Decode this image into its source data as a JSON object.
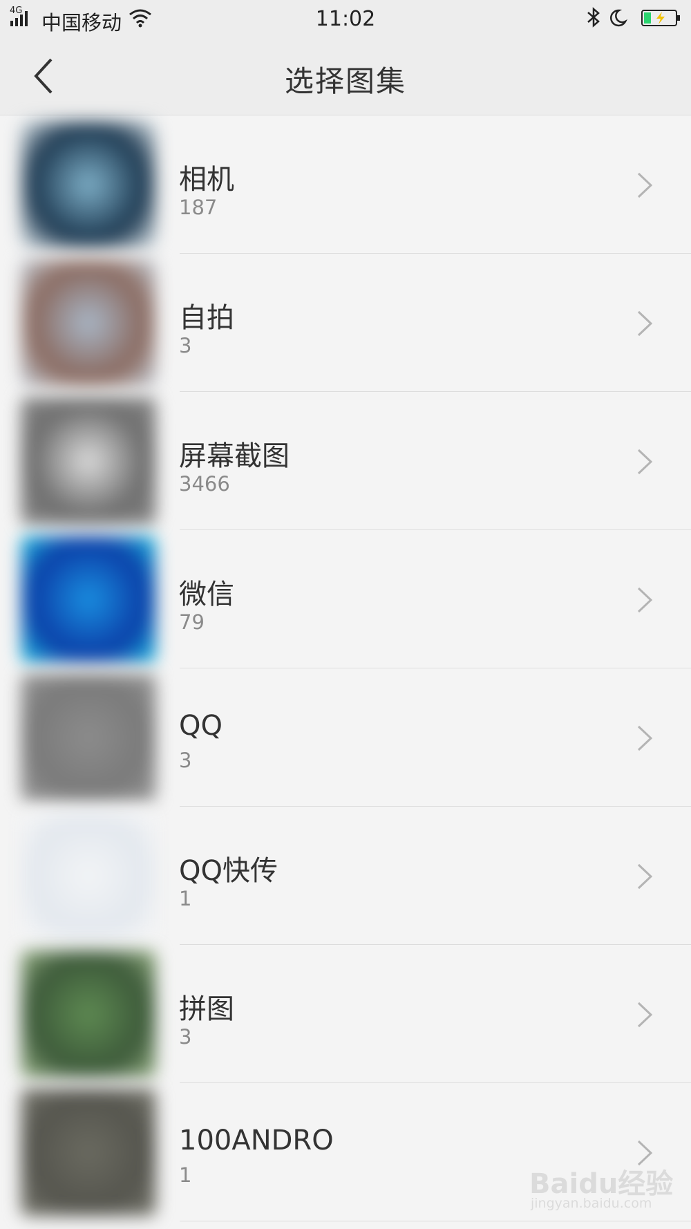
{
  "status_bar": {
    "network": "4G",
    "carrier": "中国移动",
    "time": "11:02",
    "icons": [
      "signal-icon",
      "wifi-icon",
      "bluetooth-icon",
      "moon-icon",
      "battery-charging-icon"
    ]
  },
  "nav": {
    "title": "选择图集",
    "back_icon": "chevron-left-icon"
  },
  "albums": [
    {
      "name": "相机",
      "count": "187",
      "thumb_colors": [
        "#1e3a52",
        "#7fb0c8",
        "#e6eef2"
      ]
    },
    {
      "name": "自拍",
      "count": "3",
      "thumb_colors": [
        "#8a6a60",
        "#a9b7c7",
        "#c9d4de"
      ]
    },
    {
      "name": "屏幕截图",
      "count": "3466",
      "thumb_colors": [
        "#6e6e6e",
        "#dcdcdc",
        "#8a8a8a"
      ]
    },
    {
      "name": "微信",
      "count": "79",
      "thumb_colors": [
        "#0b3fa8",
        "#1a8fe0",
        "#22c8e8"
      ]
    },
    {
      "name": "QQ",
      "count": "3",
      "thumb_colors": [
        "#7a7a7a",
        "#8c8c8c",
        "#9a9a9a"
      ]
    },
    {
      "name": "QQ快传",
      "count": "1",
      "thumb_colors": [
        "#e3e8ee",
        "#f2f4f6",
        "#f7f7f7"
      ]
    },
    {
      "name": "拼图",
      "count": "3",
      "thumb_colors": [
        "#3d5a3a",
        "#5e8a52",
        "#9ab488"
      ]
    },
    {
      "name": "100ANDRO",
      "count": "1",
      "thumb_colors": [
        "#55554e",
        "#6a6a60",
        "#7a7a70"
      ]
    }
  ],
  "watermark": {
    "logo": "Baidu经验",
    "url": "jingyan.baidu.com"
  }
}
